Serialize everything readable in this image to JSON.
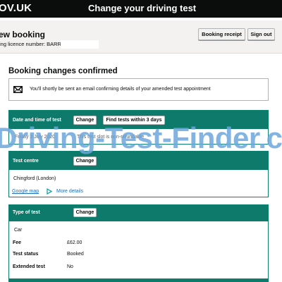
{
  "header": {
    "brand": "OV.UK",
    "service_name": "Change your driving test"
  },
  "subheader": {
    "title": "ew booking",
    "licence_label": "ing licence number: BARRY",
    "buttons": {
      "receipt": "Booking receipt",
      "signout": "Sign out"
    }
  },
  "confirmation": {
    "heading": "Booking changes confirmed",
    "message": "You'll shortly be sent an email confirming details of your amended test appointment",
    "icon": "envelope-icon"
  },
  "date_panel": {
    "title": "Date and time of test",
    "change_label": "Change",
    "find_label": "Find tests within 3 days",
    "date_text": "Friday 3 July 2020",
    "refund_text": "This test slot is non-refundable"
  },
  "centre_panel": {
    "title": "Test centre",
    "change_label": "Change",
    "centre_name": "Chingford (London)",
    "map_link": "Google map",
    "more_details": "More details",
    "more_icon": "play-triangle-icon"
  },
  "type_panel": {
    "title": "Type of test",
    "change_label": "Change",
    "type_value": "Car",
    "rows": [
      {
        "label": "Fee",
        "value": "£62.00"
      },
      {
        "label": "Test status",
        "value": "Booked"
      },
      {
        "label": "Extended test",
        "value": "No"
      }
    ]
  },
  "watermark": "Driving-Test-Finder.c",
  "colors": {
    "panel_header": "#0e7a6b",
    "link": "#1d70b8",
    "topbar": "#0b0c0c",
    "watermark": "#6da6dc"
  }
}
